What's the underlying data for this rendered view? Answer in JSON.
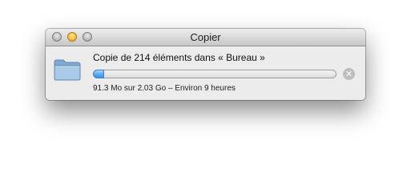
{
  "window": {
    "title": "Copier"
  },
  "copy": {
    "label": "Copie de 214 éléments dans « Bureau »",
    "status": "91.3 Mo sur 2.03 Go – Environ 9 heures",
    "progress_fraction": 0.045
  },
  "icons": {
    "destination": "folder-icon",
    "stop": "stop-icon",
    "stop_glyph": "✕"
  },
  "colors": {
    "progress_fill": "#4a9ae8",
    "folder": "#8fb6d9"
  }
}
